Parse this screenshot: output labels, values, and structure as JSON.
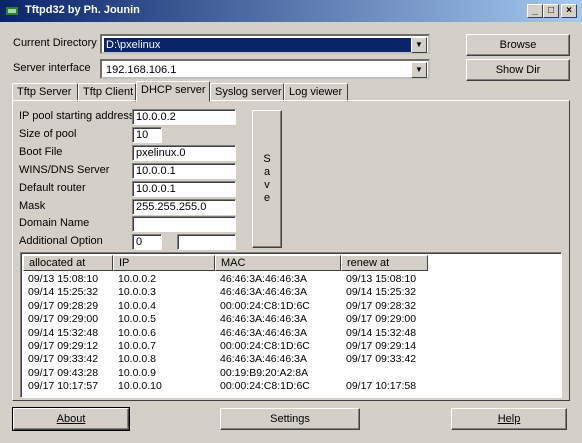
{
  "window": {
    "title": "Tftpd32 by Ph. Jounin",
    "minimize": "_",
    "maximize": "□",
    "close": "×"
  },
  "top": {
    "current_directory_label": "Current Directory",
    "current_directory_value": "D:\\pxelinux",
    "server_interface_label": "Server interface",
    "server_interface_value": "192.168.106.1",
    "browse_label": "Browse",
    "show_dir_label": "Show Dir"
  },
  "tabs": [
    "Tftp Server",
    "Tftp Client",
    "DHCP server",
    "Syslog server",
    "Log viewer"
  ],
  "active_tab": "DHCP server",
  "dhcp": {
    "pool_start_label": "IP pool starting address",
    "pool_start_value": "10.0.0.2",
    "pool_size_label": "Size of pool",
    "pool_size_value": "10",
    "boot_file_label": "Boot File",
    "boot_file_value": "pxelinux.0",
    "dns_label": "WINS/DNS Server",
    "dns_value": "10.0.0.1",
    "router_label": "Default router",
    "router_value": "10.0.0.1",
    "mask_label": "Mask",
    "mask_value": "255.255.255.0",
    "domain_label": "Domain Name",
    "domain_value": "",
    "option_label": "Additional Option",
    "option_num_value": "0",
    "option_val_value": "",
    "save_label": "Save",
    "save_letters": [
      "S",
      "a",
      "v",
      "e"
    ]
  },
  "leases": {
    "columns": [
      "allocated at",
      "IP",
      "MAC",
      "renew at"
    ],
    "rows": [
      [
        "09/13 15:08:10",
        "10.0.0.2",
        "46:46:3A:46:46:3A",
        "09/13 15:08:10"
      ],
      [
        "09/14 15:25:32",
        "10.0.0.3",
        "46:46:3A:46:46:3A",
        "09/14 15:25:32"
      ],
      [
        "09/17 09:28:29",
        "10.0.0.4",
        "00:00:24:C8:1D:6C",
        "09/17 09:28:32"
      ],
      [
        "09/17 09:29:00",
        "10.0.0.5",
        "46:46:3A:46:46:3A",
        "09/17 09:29:00"
      ],
      [
        "09/14 15:32:48",
        "10.0.0.6",
        "46:46:3A:46:46:3A",
        "09/14 15:32:48"
      ],
      [
        "09/17 09:29:12",
        "10.0.0.7",
        "00:00:24:C8:1D:6C",
        "09/17 09:29:14"
      ],
      [
        "09/17 09:33:42",
        "10.0.0.8",
        "46:46:3A:46:46:3A",
        "09/17 09:33:42"
      ],
      [
        "09/17 09:43:28",
        "10.0.0.9",
        "00:19:B9:20:A2:8A",
        ""
      ],
      [
        "09/17 10:17:57",
        "10.0.0.10",
        "00:00:24:C8:1D:6C",
        "09/17 10:17:58"
      ]
    ]
  },
  "bottom": {
    "about_label": "About",
    "settings_label": "Settings",
    "help_label": "Help"
  },
  "colors": {
    "title_start": "#0a246a",
    "title_end": "#a6caf0",
    "face": "#d4d0c8",
    "selection": "#0a246a"
  }
}
